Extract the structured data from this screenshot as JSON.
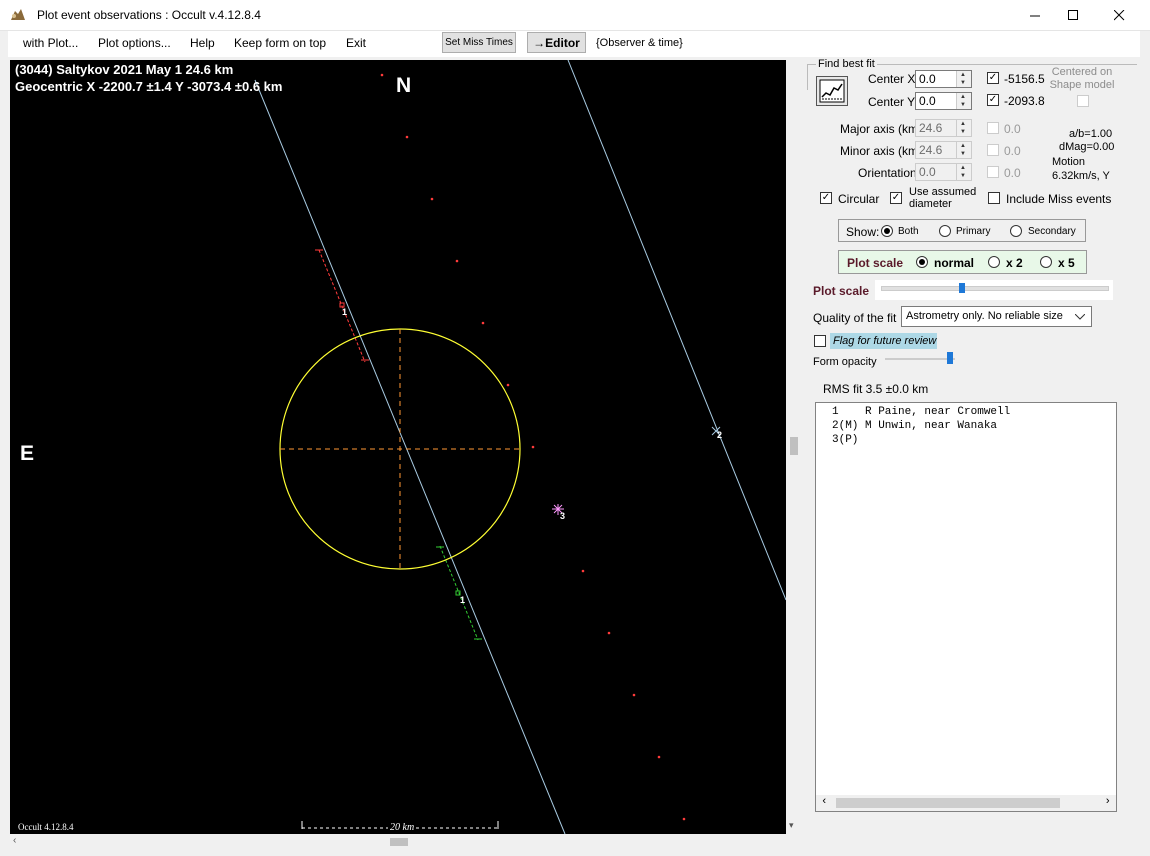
{
  "window": {
    "title": "Plot event observations : Occult v.4.12.8.4"
  },
  "menu": {
    "with_plot": "with Plot...",
    "plot_options": "Plot options...",
    "help": "Help",
    "keep_on_top": "Keep form on top",
    "exit": "Exit",
    "set_miss_times": "Set Miss Times",
    "editor": "→Editor",
    "observer_time": "{Observer & time}"
  },
  "plot": {
    "heading_line1": "(3044) Saltykov  2021 May 1  24.6 km",
    "heading_line2": "Geocentric  X  -2200.7 ±1.4  Y -3073.4 ±0.6 km",
    "north_label": "N",
    "east_label": "E",
    "version": "Occult 4.12.8.4",
    "scale_label": "20 km",
    "chord_labels": [
      "1",
      "2",
      "1",
      "3"
    ]
  },
  "panel": {
    "find_best_fit": "Find best fit",
    "center_x_label": "Center X",
    "center_x_value": "0.0",
    "center_y_label": "Center Y",
    "center_y_value": "0.0",
    "fit_x_value": "-5156.5",
    "fit_y_value": "-2093.8",
    "centered_on_shape": "Centered on Shape model",
    "major_axis_label": "Major axis (km)",
    "major_axis_value": "24.6",
    "major_axis_fit": "0.0",
    "minor_axis_label": "Minor axis (km)",
    "minor_axis_value": "24.6",
    "minor_axis_fit": "0.0",
    "orientation_label": "Orientation",
    "orientation_value": "0.0",
    "orientation_fit": "0.0",
    "ab_ratio": "a/b=1.00",
    "dmag": "dMag=0.00",
    "motion_label": "Motion",
    "motion_value": "6.32km/s, Y",
    "circular_label": "Circular",
    "use_assumed_diameter": "Use assumed diameter",
    "include_miss_events": "Include Miss events",
    "show_label": "Show:",
    "show_both": "Both",
    "show_primary": "Primary",
    "show_secondary": "Secondary",
    "plot_scale_label": "Plot scale",
    "scale_normal": "normal",
    "scale_x2": "x 2",
    "scale_x5": "x 5",
    "plot_scale_slider_label": "Plot scale",
    "quality_label": "Quality of the fit",
    "quality_value": "Astrometry only. No reliable size",
    "flag_review": "Flag for future review",
    "form_opacity": "Form opacity",
    "rms_fit": "RMS fit 3.5 ±0.0 km",
    "observers": [
      "1    R Paine, near Cromwell",
      "2(M) M Unwin, near Wanaka",
      "3(P)"
    ]
  },
  "colors": {
    "ellipse": "#ffff33",
    "axis": "#ff9933",
    "chord_line": "#a9cce3",
    "miss_dot": "#ff3b3b",
    "event_red": "#ff3b3b",
    "event_green": "#33cc33",
    "star_marker": "#ff99ff"
  }
}
